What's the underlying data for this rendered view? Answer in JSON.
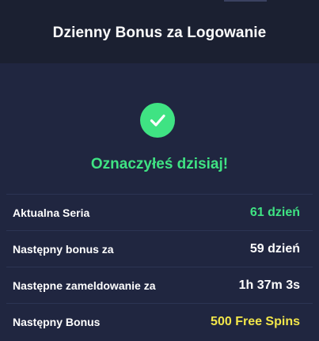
{
  "header": {
    "title": "Dzienny Bonus za Logowanie"
  },
  "status": {
    "icon": "check-icon",
    "text": "Oznaczyłeś dzisiaj!",
    "color": "#3fe383"
  },
  "rows": [
    {
      "label": "Aktualna Seria",
      "value": "61 dzień",
      "color": "#3fe383"
    },
    {
      "label": "Następny bonus za",
      "value": "59 dzień",
      "color": "#ffffff"
    },
    {
      "label": "Następne zameldowanie za",
      "value": "1h 37m 3s",
      "color": "#ffffff"
    },
    {
      "label": "Następny Bonus",
      "value": "500 Free Spins",
      "color": "#f2e64a"
    }
  ]
}
